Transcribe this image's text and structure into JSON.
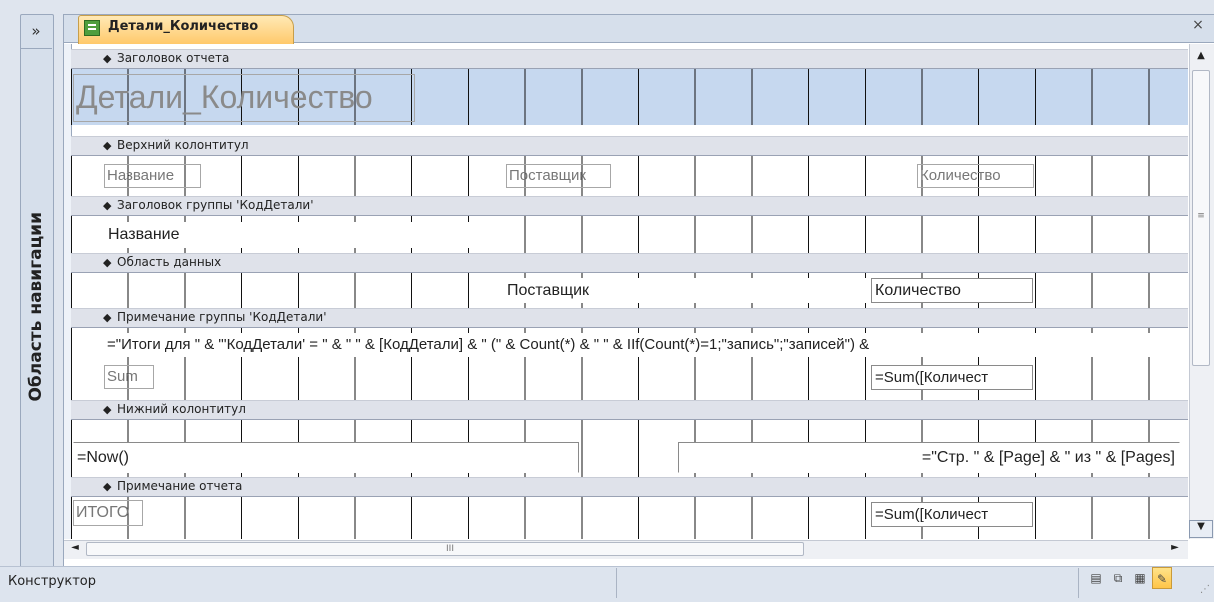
{
  "navigation": {
    "toggle_label": "»",
    "pane_label": "Область навигации"
  },
  "tab": {
    "title": "Детали_Количество",
    "close": "×"
  },
  "sections": {
    "report_header": "Заголовок отчета",
    "page_header": "Верхний колонтитул",
    "group_header": "Заголовок группы 'КодДетали'",
    "detail": "Область данных",
    "group_footer": "Примечание группы 'КодДетали'",
    "page_footer": "Нижний колонтитул",
    "report_footer": "Примечание отчета"
  },
  "controls": {
    "report_title": "Детали_Количество",
    "header_name": "Название",
    "header_supplier": "Поставщик",
    "header_quantity": "Количество",
    "group_name": "Название",
    "detail_supplier": "Поставщик",
    "detail_quantity": "Количество",
    "group_summary_expr": "=\"Итоги для \" & \"'КодДетали' = \" & \" \" & [КодДетали] & \" (\" & Count(*) & \" \" & IIf(Count(*)=1;\"запись\";\"записей\") &",
    "group_sum_label": "Sum",
    "group_sum_expr": "=Sum([Количест",
    "page_footer_now": "=Now()",
    "page_footer_pages": "=\"Стр. \" & [Page] & \" из \" & [Pages]",
    "report_total_label": "ИТОГО",
    "report_sum_expr": "=Sum([Количест"
  },
  "scrollbars": {
    "up": "▲",
    "down": "▼",
    "left": "◄",
    "right": "►",
    "grip_v": "≡",
    "grip_h": "III"
  },
  "status": {
    "mode": "Конструктор",
    "view_buttons": [
      "report-view-icon",
      "print-preview-icon",
      "layout-view-icon",
      "design-view-icon"
    ],
    "active_view": "design-view-icon"
  },
  "colors": {
    "accent_tab": "#ffc96b",
    "report_header_fill": "#c6d8ef",
    "band_fill": "#dfe2ea"
  }
}
